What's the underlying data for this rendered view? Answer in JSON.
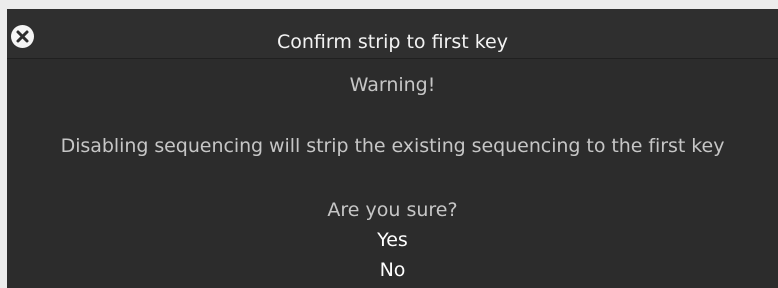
{
  "dialog": {
    "title": "Confirm strip to first key",
    "close_icon": "close-icon",
    "warning": "Warning!",
    "message": "Disabling sequencing will strip the existing sequencing to the first key",
    "question": "Are you sure?",
    "yes_label": "Yes",
    "no_label": "No"
  },
  "colors": {
    "page_background": "#ececec",
    "dialog_background": "#2c2c2c",
    "title_text": "#f2f2f2",
    "body_text": "#c6c6c6",
    "option_text": "#ffffff",
    "close_icon_fill": "#f4f4f4",
    "close_icon_cross": "#2c2c2c"
  }
}
